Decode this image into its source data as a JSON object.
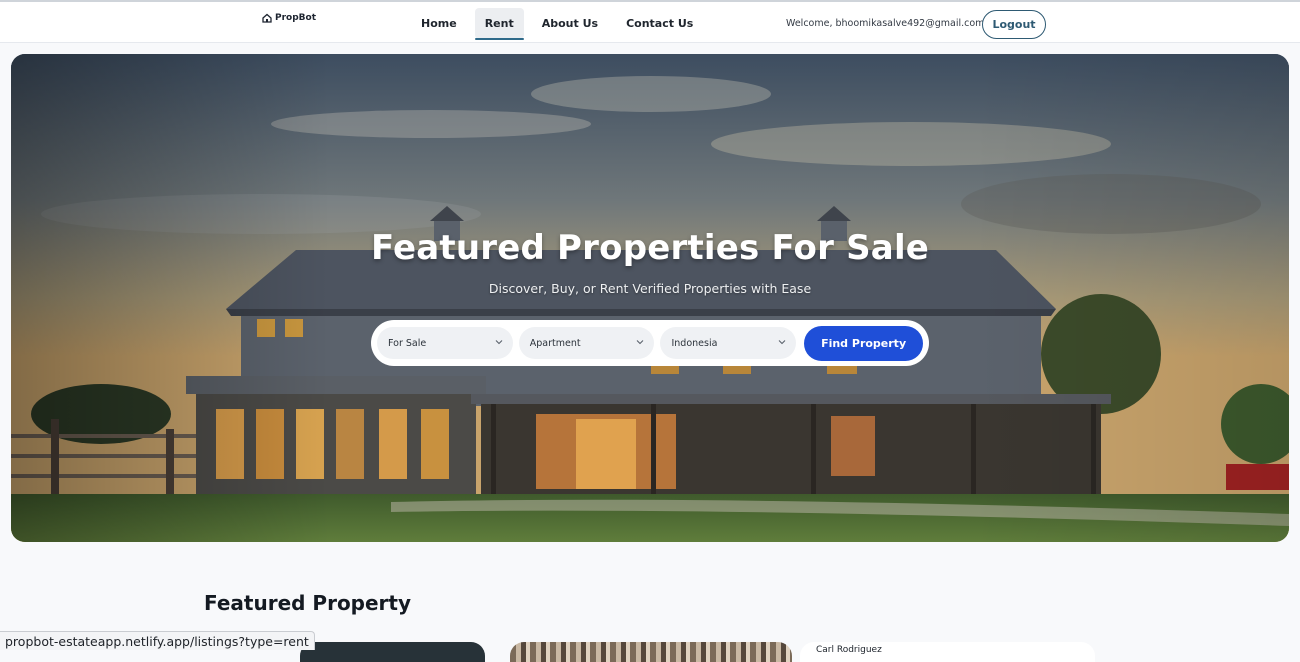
{
  "nav": {
    "logo_text": "PropBot",
    "links": [
      {
        "label": "Home"
      },
      {
        "label": "Rent",
        "active": true
      },
      {
        "label": "About Us"
      },
      {
        "label": "Contact Us"
      }
    ],
    "welcome_text": "Welcome, bhoomikasalve492@gmail.com",
    "logout_label": "Logout"
  },
  "hero": {
    "title": "Featured Properties For Sale",
    "subtitle": "Discover, Buy, or Rent Verified Properties with Ease",
    "search": {
      "type_value": "For Sale",
      "category_value": "Apartment",
      "location_value": "Indonesia",
      "button_label": "Find Property"
    }
  },
  "featured": {
    "title": "Featured Property",
    "card3_author": "Carl Rodriguez"
  },
  "statusbar": {
    "url": "propbot-estateapp.netlify.app/listings?type=rent"
  },
  "colors": {
    "accent": "#1f4fd8",
    "logout_border": "#2e5a73"
  }
}
